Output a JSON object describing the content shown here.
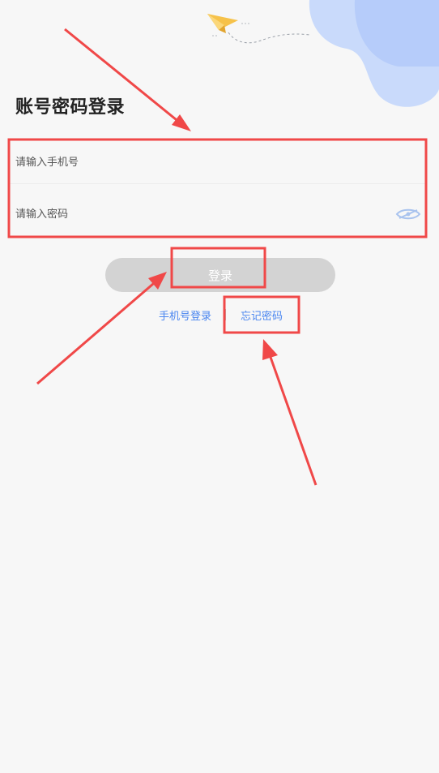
{
  "page": {
    "title": "账号密码登录"
  },
  "form": {
    "phone_placeholder": "请输入手机号",
    "password_placeholder": "请输入密码",
    "password_visibility_icon": "eye-closed-icon"
  },
  "actions": {
    "login_label": "登录",
    "phone_login_link": "手机号登录",
    "forgot_password_link": "忘记密码"
  },
  "decor": {
    "paper_plane_icon": "paper-plane-icon",
    "blob_color": "#c7d9fb",
    "plane_color": "#f6c24a"
  },
  "annotations": {
    "box_color": "#f04848",
    "arrow_color": "#f04848"
  },
  "colors": {
    "link": "#4a86f0",
    "button_disabled": "#d3d3d3",
    "background": "#f7f7f7"
  }
}
